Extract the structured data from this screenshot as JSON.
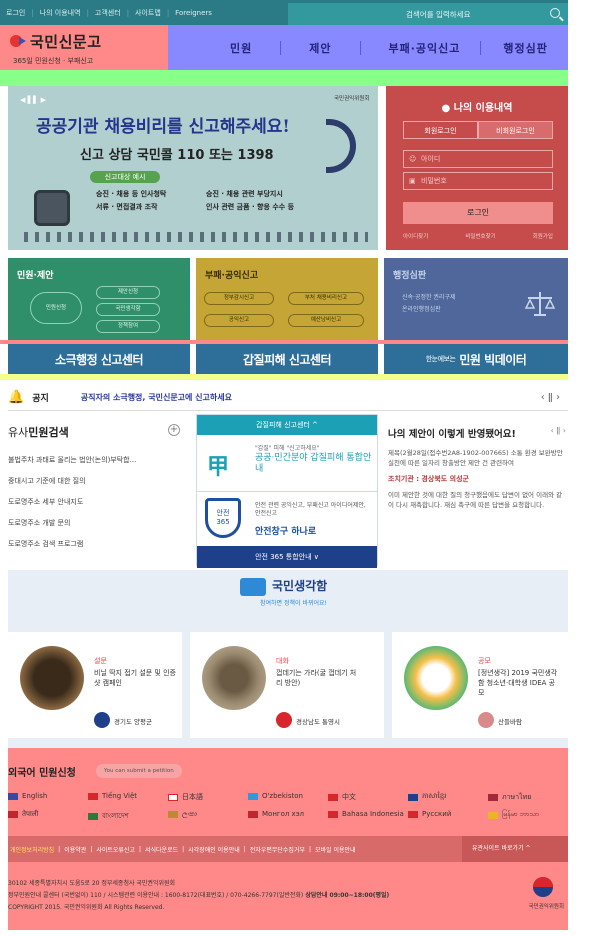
{
  "topbar": {
    "links": [
      "로그인",
      "나의 이용내역",
      "고객센터",
      "사이트맵",
      "Foreigners"
    ],
    "search_placeholder": "검색어를 입력하세요"
  },
  "logo": {
    "title": "국민신문고",
    "subtitle": "365일 민원신청 · 부패신고"
  },
  "nav": {
    "items": [
      "민원",
      "제안",
      "부패·공익신고",
      "행정심판"
    ]
  },
  "banner": {
    "agency": "국민권익위원회",
    "headline": "공공기관 채용비리를 신고해주세요!",
    "call": "신고 상담  국민콜 110 또는 1398",
    "targets_label": "신고대상 예시",
    "items_left": [
      "승진 · 채용 등 인사청탁",
      "서류 · 면접결과 조작"
    ],
    "items_right": [
      "승진 · 채용 관련 부당지시",
      "인사 관련 금품 · 향응 수수 등"
    ]
  },
  "login": {
    "title": "나의 이용내역",
    "tab_member": "회원로그인",
    "tab_nonmember": "비회원로그인",
    "id_placeholder": "아이디",
    "pw_placeholder": "비밀번호",
    "submit": "로그인",
    "links": [
      "아이디찾기",
      "비밀번호찾기",
      "회원가입"
    ]
  },
  "tiles": {
    "minwon": {
      "title": "민원·제안",
      "chips": [
        "민원신청",
        "제안신청",
        "국민생각함",
        "정책참여"
      ]
    },
    "corruption": {
      "title": "부패·공익신고",
      "chips": [
        "정부감시신고",
        "부처 채용비리신고",
        "공익신고",
        "예산낭비신고"
      ]
    },
    "admin": {
      "title": "행정심판",
      "desc": [
        "신속·공정한 권리구제",
        "온라인행정심판"
      ]
    }
  },
  "strips": {
    "s1": "소극행정 신고센터",
    "s2": "갑질피해 신고센터",
    "s3_prefix": "한눈에보는",
    "s3": "민원 빅데이터"
  },
  "notice": {
    "label": "공지",
    "text": "공직자의 소극행정, 국민신문고에 신고하세요",
    "controls": "‹ ǁ ›"
  },
  "similar": {
    "title_a": "유사",
    "title_b": "민원검색",
    "items": [
      "불법주차 과태료 올리는 법안(논의)부탁합...",
      "중대시고 기준에 대한 질의",
      "도로명주소 세부 안내지도",
      "도로명주소 개발 문의",
      "도로명주소 검색 프로그램"
    ]
  },
  "center_cards": {
    "gapjil_head": "갑질피해 신고센터 ^",
    "gapjil_quote": "\"갑질\" 피해 \"신고하세요\"",
    "gapjil_main": "공공·민간분야 갑질피해 통합안내",
    "safety_desc": "안전 관련 공익신고, 부패신고 아이디어제안, 안전신고",
    "safety_main": "안전창구 하나로",
    "safety_foot": "안전 365 통합안내 ∨"
  },
  "my_proposal": {
    "title": "나의 제안이 이렇게 반영됐어요!",
    "controls": "‹ ǁ ›",
    "para1": "제목(2월28일(접수번2A8-1902-007665) 소통 환경 보완방안 실천에 따른 일자리 창출방안 제안 건 관련하여",
    "agency": "조치기관 : 경상북도 의성군",
    "para2": "이미 제안한 것에 대한 질의 청구했음에도 답변이 없어 이래와 같이 다시 재촉합니다. 재심 촉구에 따른 답변을 요청합니다."
  },
  "idea": {
    "title": "국민생각함",
    "sub": "참여하면 정책이 바뀌어요!"
  },
  "cards": [
    {
      "cat": "설문",
      "desc": "비닐 딱지 접기 설문 및 인증샷 캠페인",
      "org": "경기도 양평군"
    },
    {
      "cat": "대화",
      "desc": "껍데기는 가라(굴 껍데기 처리 방안)",
      "org": "경상남도 통영시"
    },
    {
      "cat": "공모",
      "desc": "[정년생각] 2019 국민생각함 청소년·대학생 IDEA 공모",
      "org": "산들바람"
    }
  ],
  "foreign": {
    "title": "외국어 민원신청",
    "badge": "You can submit a petition",
    "langs": [
      "English",
      "Tiếng Việt",
      "日本語",
      "O'zbekiston",
      "中文",
      "ភាសាខ្មែរ",
      "ภาษาไทย",
      "तेपाली",
      "বাংলাদেশ",
      "ලංකා",
      "Монгол хэл",
      "Bahasa Indonesia",
      "Русский",
      "မြန်မာ ဘာသာ"
    ]
  },
  "footer": {
    "links": [
      "개인정보처리방침",
      "이용약관",
      "사이트오류신고",
      "서식다운로드",
      "시각장애인 이용안내",
      "전자우편무단수집거부",
      "모바일 이용안내"
    ],
    "related": "유관사이트 바로가기  ^",
    "address": "30102 세종특별자치시 도움5로 20 정부세종청사 국민권익위원회",
    "phone_a": "정부민원안내 콜센터 (국번없이) 110 / 시스템관련 이용안내 : 1600-8172(대표번호) / 070-4266-7797(일반전화)",
    "phone_b": " 상담안내 09:00~18:00(평일)",
    "copyright": "COPYRIGHT 2015. 국민권익위원회 All Rights Reserved.",
    "org": "국민권익위원회"
  },
  "colors": {
    "teal": "#2b7b86",
    "nav": "#8888ff",
    "red": "#c64c4c",
    "green": "#2f8f6a",
    "gold": "#c4a535",
    "slate": "#4f679a"
  }
}
